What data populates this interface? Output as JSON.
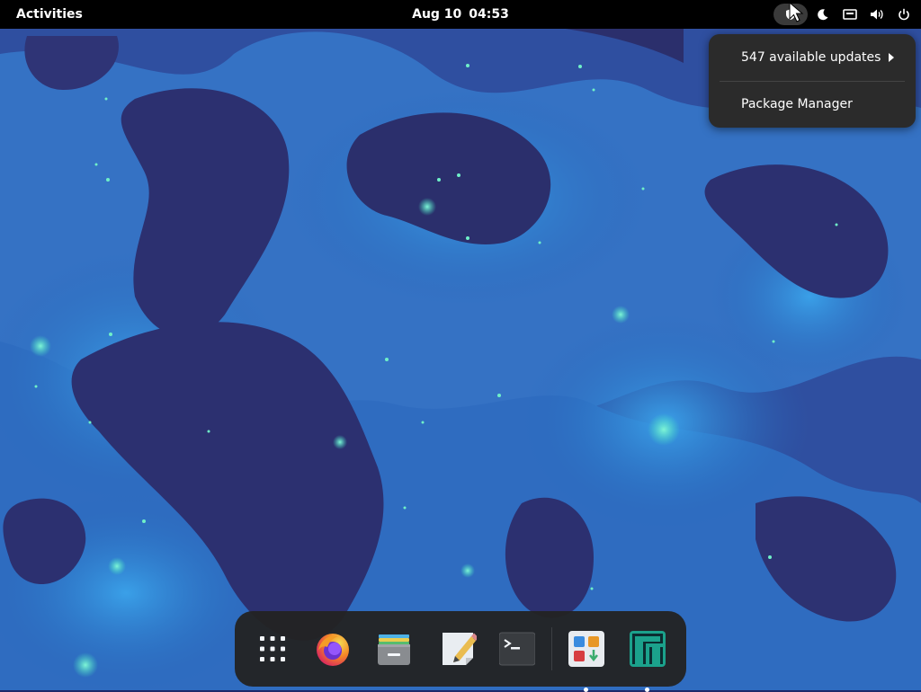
{
  "topbar": {
    "activities": "Activities",
    "date": "Aug 10",
    "time": "04:53"
  },
  "status_icons": [
    "updates-shield-icon",
    "night-light-icon",
    "network-wired-icon",
    "volume-icon",
    "power-icon"
  ],
  "update_menu": {
    "updates_label": "547 available updates",
    "package_manager_label": "Package Manager"
  },
  "dock": {
    "items": [
      {
        "name": "show-apps-button",
        "icon": "app-grid-icon",
        "running": false
      },
      {
        "name": "firefox-launcher",
        "icon": "firefox-icon",
        "running": false
      },
      {
        "name": "files-launcher",
        "icon": "file-cabinet-icon",
        "running": false
      },
      {
        "name": "text-editor-launcher",
        "icon": "text-editor-icon",
        "running": false
      },
      {
        "name": "terminal-launcher",
        "icon": "terminal-icon",
        "running": false
      },
      {
        "name": "software-launcher",
        "icon": "software-store-icon",
        "running": true
      },
      {
        "name": "manjaro-launcher",
        "icon": "manjaro-logo-icon",
        "running": true
      }
    ]
  },
  "colors": {
    "topbar": "#000000",
    "menu_bg": "#2b2b2b",
    "dock_bg": "#232323",
    "wallpaper_dark": "#2a3470",
    "wallpaper_light": "#2f7ed0",
    "wallpaper_glow": "#3fe0c0",
    "manjaro_green": "#1aa58a"
  }
}
